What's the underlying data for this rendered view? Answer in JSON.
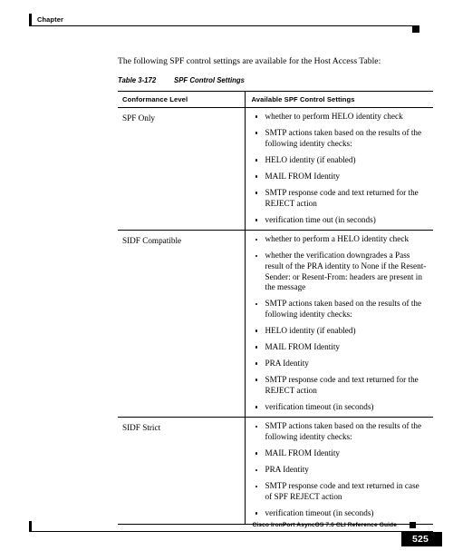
{
  "header": {
    "chapter_label": "Chapter"
  },
  "body": {
    "intro_paragraph": "The following SPF control settings are available for the Host Access Table:",
    "table_caption_number": "Table 3-172",
    "table_caption_title": "SPF Control Settings"
  },
  "table": {
    "columns": [
      "Conformance Level",
      "Available SPF Control Settings"
    ],
    "rows": [
      {
        "conformance_level": "SPF Only",
        "settings": [
          "whether to perform HELO identity check",
          "SMTP actions taken based on the results of the following identity checks:",
          "HELO identity (if enabled)",
          "MAIL FROM Identity",
          "SMTP response code and text returned for the REJECT action",
          "verification time out (in seconds)"
        ]
      },
      {
        "conformance_level": "SIDF Compatible",
        "settings": [
          "whether to perform a HELO identity check",
          "whether the verification downgrades a Pass result of the PRA identity to None if the Resent-Sender: or Resent-From: headers are present in the message",
          "SMTP actions taken based on the results of the following identity checks:",
          "HELO identity (if enabled)",
          "MAIL FROM Identity",
          "PRA Identity",
          "SMTP response code and text returned for the REJECT action",
          "verification timeout (in seconds)"
        ]
      },
      {
        "conformance_level": "SIDF Strict",
        "settings": [
          "SMTP actions taken based on the results of the following identity checks:",
          "MAIL FROM Identity",
          "PRA Identity",
          "SMTP response code and text returned in case of SPF REJECT action",
          "verification timeout (in seconds)"
        ]
      }
    ]
  },
  "footer": {
    "guide_title": "Cisco IronPort AsyncOS 7.6 CLI Reference Guide",
    "page_number": "525"
  }
}
